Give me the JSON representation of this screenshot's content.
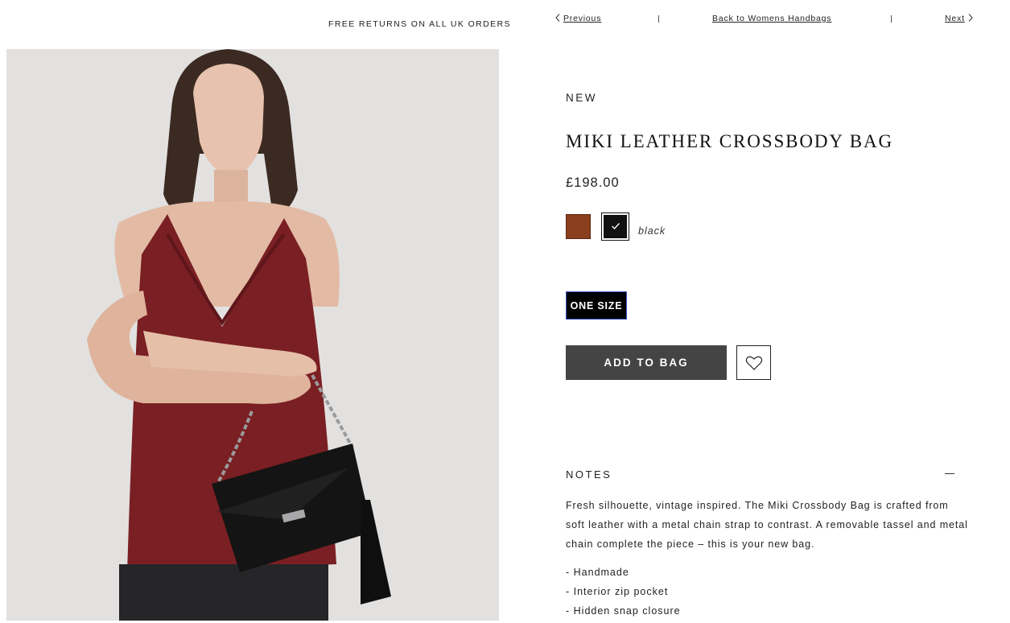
{
  "promo": {
    "text": "FREE RETURNS ON ALL UK ORDERS"
  },
  "nav": {
    "previous": "Previous",
    "back": "Back to Womens Handbags",
    "next": "Next"
  },
  "product": {
    "badge": "NEW",
    "title": "MIKI LEATHER CROSSBODY BAG",
    "price": "£198.00",
    "swatches": [
      {
        "name": "tan",
        "color": "#8a3f1e",
        "selected": false
      },
      {
        "name": "black",
        "color": "#111111",
        "selected": true
      }
    ],
    "selected_color": "black",
    "size": "ONE SIZE",
    "add_to_bag": "ADD TO BAG"
  },
  "notes": {
    "heading": "NOTES",
    "description": "Fresh silhouette, vintage inspired. The Miki Crossbody Bag is crafted from soft leather with a metal chain strap to contrast. A removable tassel and metal chain complete the piece – this is your new bag.",
    "features": [
      "- Handmade",
      "- Interior zip pocket",
      "- Hidden snap closure"
    ]
  },
  "icons": {
    "prev": "chevron-left-icon",
    "next": "chevron-right-icon",
    "wishlist": "heart-icon",
    "check": "check-icon",
    "collapse": "minus-icon"
  }
}
